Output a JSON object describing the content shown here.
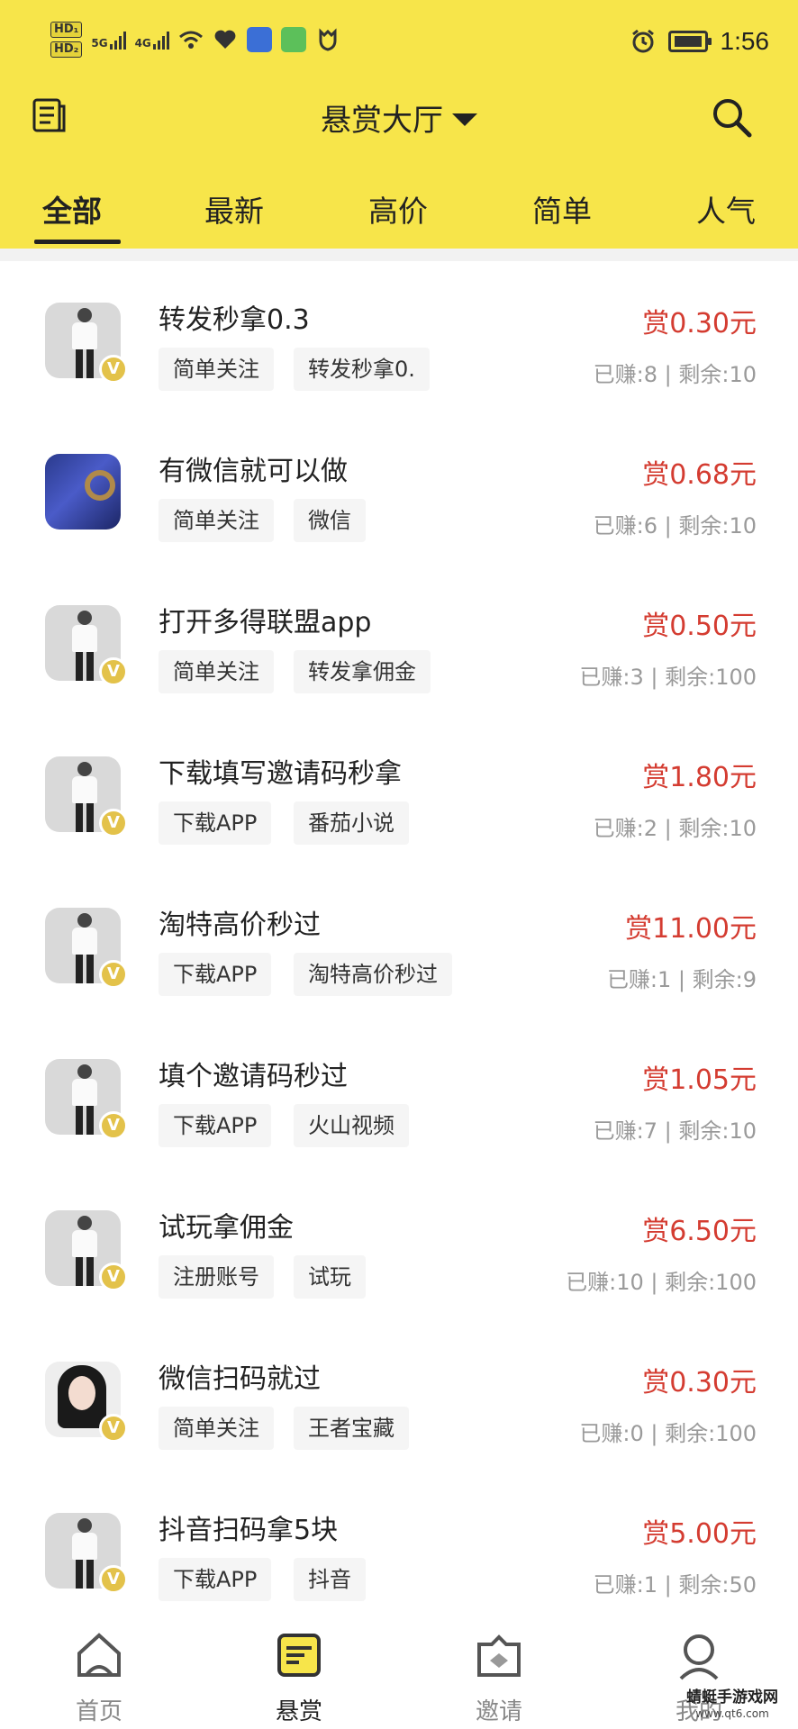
{
  "status_bar": {
    "hd1": "HD₁",
    "hd2": "HD₂",
    "net1": "5G",
    "net2": "4G",
    "time": "1:56",
    "icons": [
      "wifi-icon",
      "heart-icon",
      "app-icon",
      "app-icon",
      "shield-icon",
      "alarm-icon",
      "battery-icon"
    ]
  },
  "nav": {
    "title": "悬赏大厅",
    "left_icon": "list-icon",
    "right_icon": "search-icon"
  },
  "tabs": [
    "全部",
    "最新",
    "高价",
    "简单",
    "人气"
  ],
  "active_tab": 0,
  "tasks": [
    {
      "title": "转发秒拿0.3",
      "tags": [
        "简单关注",
        "转发秒拿0."
      ],
      "reward": "赏0.30元",
      "stats": "已赚:8 | 剩余:10",
      "avatar": "figure"
    },
    {
      "title": "有微信就可以做",
      "tags": [
        "简单关注",
        "微信"
      ],
      "reward": "赏0.68元",
      "stats": "已赚:6 | 剩余:10",
      "avatar": "blue"
    },
    {
      "title": "打开多得联盟app",
      "tags": [
        "简单关注",
        "转发拿佣金"
      ],
      "reward": "赏0.50元",
      "stats": "已赚:3 | 剩余:100",
      "avatar": "figure"
    },
    {
      "title": "下载填写邀请码秒拿",
      "tags": [
        "下载APP",
        "番茄小说"
      ],
      "reward": "赏1.80元",
      "stats": "已赚:2 | 剩余:10",
      "avatar": "figure"
    },
    {
      "title": "淘特高价秒过",
      "tags": [
        "下载APP",
        "淘特高价秒过"
      ],
      "reward": "赏11.00元",
      "stats": "已赚:1 | 剩余:9",
      "avatar": "figure"
    },
    {
      "title": "填个邀请码秒过",
      "tags": [
        "下载APP",
        "火山视频"
      ],
      "reward": "赏1.05元",
      "stats": "已赚:7 | 剩余:10",
      "avatar": "figure"
    },
    {
      "title": "试玩拿佣金",
      "tags": [
        "注册账号",
        "试玩"
      ],
      "reward": "赏6.50元",
      "stats": "已赚:10 | 剩余:100",
      "avatar": "figure"
    },
    {
      "title": "微信扫码就过",
      "tags": [
        "简单关注",
        "王者宝藏"
      ],
      "reward": "赏0.30元",
      "stats": "已赚:0 | 剩余:100",
      "avatar": "girl"
    },
    {
      "title": "抖音扫码拿5块",
      "tags": [
        "下载APP",
        "抖音"
      ],
      "reward": "赏5.00元",
      "stats": "已赚:1 | 剩余:50",
      "avatar": "figure"
    }
  ],
  "badge_letter": "V",
  "bottom_tabs": [
    {
      "label": "首页",
      "icon": "home-icon"
    },
    {
      "label": "悬赏",
      "icon": "reward-icon"
    },
    {
      "label": "邀请",
      "icon": "invite-icon"
    },
    {
      "label": "我的",
      "icon": "profile-icon"
    }
  ],
  "active_bottom_tab": 1,
  "watermark": {
    "text": "蜻蜓手游戏网",
    "url": "www.qt6.com"
  },
  "colors": {
    "header_bg": "#f7e54a",
    "reward": "#d43c31",
    "stats": "#9a9a9a",
    "tag_bg": "#f5f5f5",
    "badge": "#e3c24a"
  }
}
